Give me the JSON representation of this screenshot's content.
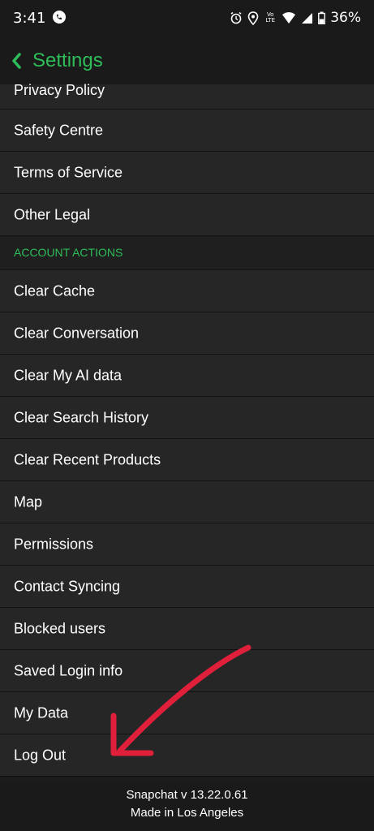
{
  "status_bar": {
    "time": "3:41",
    "battery": "36%",
    "network_top": "Vo",
    "network_bottom": "LTE"
  },
  "header": {
    "title": "Settings"
  },
  "list": {
    "partial_item": "Privacy Policy",
    "items_before": [
      "Safety Centre",
      "Terms of Service",
      "Other Legal"
    ],
    "section_header": "ACCOUNT ACTIONS",
    "items": [
      "Clear Cache",
      "Clear Conversation",
      "Clear My AI data",
      "Clear Search History",
      "Clear Recent Products",
      "Map",
      "Permissions",
      "Contact Syncing",
      "Blocked users",
      "Saved Login info",
      "My Data",
      "Log Out"
    ]
  },
  "footer": {
    "version": "Snapchat v 13.22.0.61",
    "made_in": "Made in Los Angeles"
  },
  "colors": {
    "accent": "#2ebd59",
    "annotation_arrow": "#e0203a"
  }
}
